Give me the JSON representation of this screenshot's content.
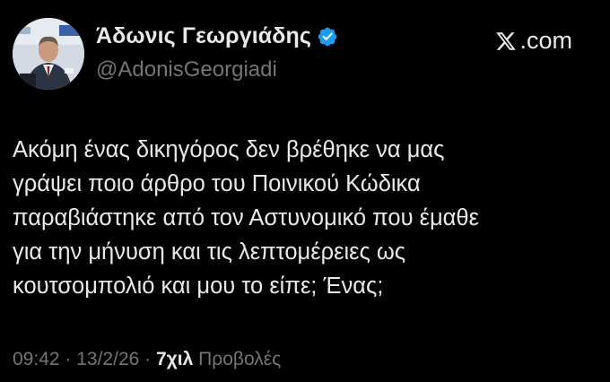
{
  "author": {
    "display_name": "Άδωνις Γεωργιάδης",
    "handle": "@AdonisGeorgiadi",
    "verified_icon": "verified-badge-icon"
  },
  "brand": {
    "text": ".com",
    "icon": "x-logo-icon"
  },
  "tweet": {
    "lines": [
      "Ακόμη ένας δικηγόρος δεν βρέθηκε να μας",
      "γράψει ποιο άρθρο του Ποινικού Κώδικα",
      "παραβιάστηκε από τον Αστυνομικό που έμαθε",
      "για την μήνυση και τις λεπτομέρειες ως",
      "κουτσομπολιό και μου το είπε; Ένας;"
    ]
  },
  "meta": {
    "time": "09:42",
    "separator": " · ",
    "date": "13/2/26",
    "views_count": "7χιλ",
    "views_label": " Προβολές"
  },
  "colors": {
    "background": "#000000",
    "text_primary": "#e7e9ea",
    "text_secondary": "#71767b",
    "verified_blue": "#1d9bf0"
  }
}
